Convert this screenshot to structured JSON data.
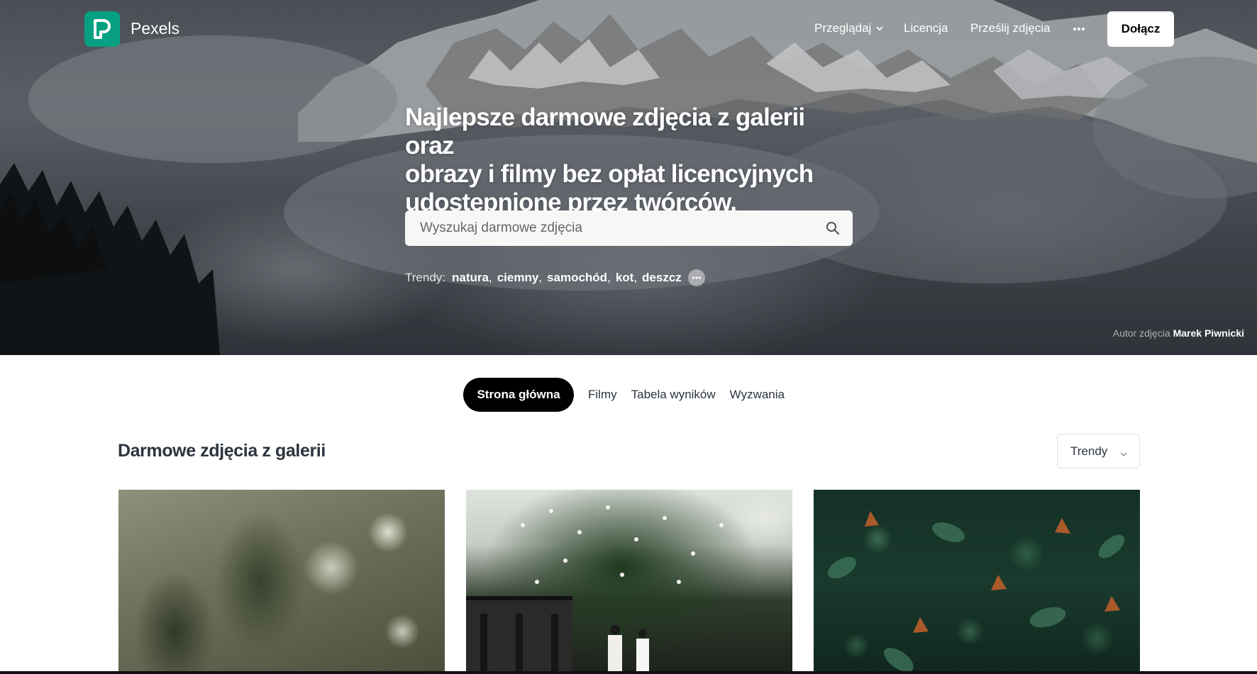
{
  "brand": {
    "name": "Pexels",
    "color": "#05a081"
  },
  "nav": {
    "browse": "Przeglądaj",
    "license": "Licencja",
    "upload": "Prześlij zdjęcia",
    "join": "Dołącz"
  },
  "hero": {
    "title_lines": [
      "Najlepsze darmowe zdjęcia z galerii oraz",
      "obrazy i filmy bez opłat licencyjnych",
      "udostępnione przez twórców."
    ],
    "search_placeholder": "Wyszukaj darmowe zdjęcia",
    "trends_label": "Trendy:",
    "trends": [
      "natura",
      "ciemny",
      "samochód",
      "kot",
      "deszcz"
    ],
    "credit_label": "Autor zdjęcia",
    "credit_author": "Marek Piwnicki"
  },
  "tabs": [
    {
      "label": "Strona główna",
      "active": true
    },
    {
      "label": "Filmy",
      "active": false
    },
    {
      "label": "Tabela wyników",
      "active": false
    },
    {
      "label": "Wyzwania",
      "active": false
    }
  ],
  "gallery": {
    "title": "Darmowe zdjęcia z galerii",
    "sort_value": "Trendy"
  },
  "icons": {
    "logo": "pexels-logo-icon",
    "browse_chevron": "chevron-down-icon",
    "more": "more-horizontal-icon",
    "search": "search-icon",
    "trends_more": "more-horizontal-icon",
    "sort_chevron": "chevron-down-icon"
  }
}
